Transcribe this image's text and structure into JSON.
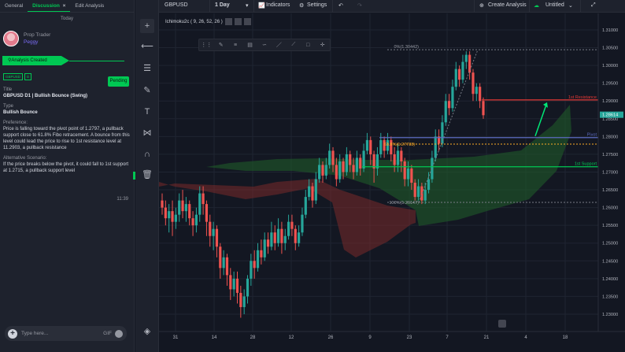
{
  "left_panel": {
    "tabs": [
      {
        "label": "General"
      },
      {
        "label": "Discussion",
        "close": "×"
      },
      {
        "label": "Edit Analysis"
      }
    ],
    "today": "Today",
    "user": {
      "role": "Prop Trader",
      "name": "Peggy"
    },
    "analysis_created": "Analysis Created",
    "badge_pair": "GBPUSD",
    "badge_tf": "D",
    "status": "Pending",
    "title_label": "Title",
    "title_value": "GBPUSD D1 | Bullish Bounce (Swing)",
    "type_label": "Type",
    "type_value": "Bullish Bounce",
    "preference_label": "Preference:",
    "preference_text": "Price is falling toward the pivot point of 1.2797, a pullback support close to 61.8% Fibo retracement. A bounce from this level could lead the price to rise to 1st resistance level at 11.2903, a pullback resistance",
    "alt_label": "Alternative Scenario:",
    "alt_text": "If the price breaks below the pivot, it could fall  to 1st support at 1.2715, a pullback support  level",
    "time": "11:39",
    "input_placeholder": "Type here...",
    "gif_label": "GIF"
  },
  "topbar": {
    "symbol": "GBPUSD",
    "interval": "1 Day",
    "indicators": "Indicators",
    "settings": "Settings",
    "create_analysis": "Create Analysis",
    "layout_name": "Untitled"
  },
  "chart": {
    "indicator_label": "Ichimoku2c ( 9, 26, 52, 26 )",
    "price_labels": [
      "1.31000",
      "1.30500",
      "1.30000",
      "1.29500",
      "1.29000",
      "1.28500",
      "1.28000",
      "1.27500",
      "1.27000",
      "1.26500",
      "1.26000",
      "1.25500",
      "1.25000",
      "1.24500",
      "1.24000",
      "1.23500",
      "1.23000"
    ],
    "current_price": "1.28614",
    "time_labels": [
      "31",
      "14",
      "28",
      "12",
      "26",
      "9",
      "23",
      "7",
      "21",
      "4",
      "18"
    ],
    "fib": {
      "f0": "0%(1.30442)",
      "f618": "61.8%(1.27788)",
      "f100": "100%(1.26147)"
    },
    "levels": {
      "resistance": "1st Resistance",
      "pivot": "Pivot",
      "support": "1st Support"
    },
    "colors": {
      "up": "#26a69a",
      "down": "#ef5350",
      "resistance": "#e53935",
      "pivot": "#5c6bc0",
      "support": "#00c853",
      "fib618": "#f9a825"
    }
  }
}
